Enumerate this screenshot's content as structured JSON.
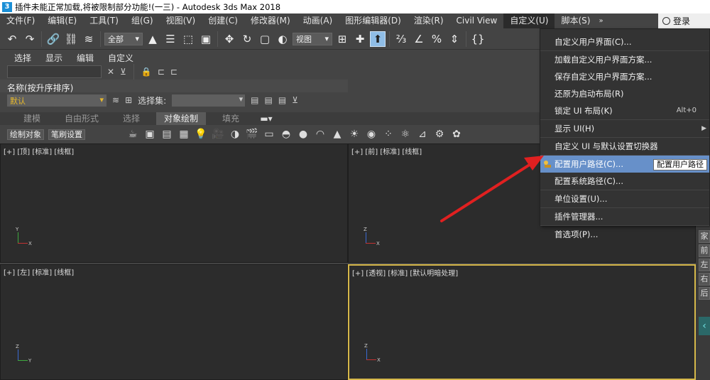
{
  "window": {
    "title": "插件未能正常加载,将被限制部分功能!(一三) - Autodesk 3ds Max 2018",
    "icon": "3"
  },
  "menubar": {
    "items": [
      "文件(F)",
      "编辑(E)",
      "工具(T)",
      "组(G)",
      "视图(V)",
      "创建(C)",
      "修改器(M)",
      "动画(A)",
      "图形编辑器(D)",
      "渲染(R)",
      "Civil View",
      "自定义(U)",
      "脚本(S)"
    ],
    "active": "自定义(U)",
    "more": "»",
    "login": "登录"
  },
  "toolbar": {
    "filter_select": "全部",
    "view_select": "视图"
  },
  "explorer": {
    "tabs": [
      "选择",
      "显示",
      "编辑",
      "自定义"
    ],
    "column_header": "名称(按升序排序)",
    "layer_value": "默认",
    "selection_set_label": "选择集:"
  },
  "ribbon": {
    "tabs": [
      "建模",
      "自由形式",
      "选择",
      "对象绘制",
      "填充"
    ],
    "active_tab": "对象绘制",
    "sub_buttons": [
      "绘制对象",
      "笔刷设置"
    ]
  },
  "viewports": [
    {
      "label": "[+] [顶] [标准] [线框]"
    },
    {
      "label": "[+] [前] [标准] [线框]"
    },
    {
      "label": "[+] [左] [标准] [线框]"
    },
    {
      "label": "[+] [透视] [标准] [默认明暗处理]"
    }
  ],
  "dropdown": {
    "items": [
      {
        "label": "自定义用户界面(C)...",
        "shortcut": "",
        "submenu": false
      },
      {
        "label": "加载自定义用户界面方案...",
        "shortcut": "",
        "submenu": false
      },
      {
        "label": "保存自定义用户界面方案...",
        "shortcut": "",
        "submenu": false
      },
      {
        "label": "还原为启动布局(R)",
        "shortcut": "",
        "submenu": false
      },
      {
        "label": "锁定 UI 布局(K)",
        "shortcut": "Alt+0",
        "submenu": false
      },
      {
        "label": "显示 UI(H)",
        "shortcut": "",
        "submenu": true
      },
      {
        "label": "自定义 UI 与默认设置切换器",
        "shortcut": "",
        "submenu": false
      },
      {
        "label": "配置用户路径(C)...",
        "shortcut": "",
        "submenu": false,
        "active": true
      },
      {
        "label": "配置系统路径(C)...",
        "shortcut": "",
        "submenu": false
      },
      {
        "label": "单位设置(U)...",
        "shortcut": "",
        "submenu": false
      },
      {
        "label": "插件管理器...",
        "shortcut": "",
        "submenu": false
      },
      {
        "label": "首选项(P)...",
        "shortcut": "",
        "submenu": false
      }
    ]
  },
  "tooltip": "配置用户路径",
  "right_panel": [
    "家",
    "前",
    "左",
    "右",
    "后"
  ],
  "colors": {
    "accent": "#6790c9",
    "annotation_arrow": "#e02020",
    "active_viewport_border": "#d6b84a"
  }
}
